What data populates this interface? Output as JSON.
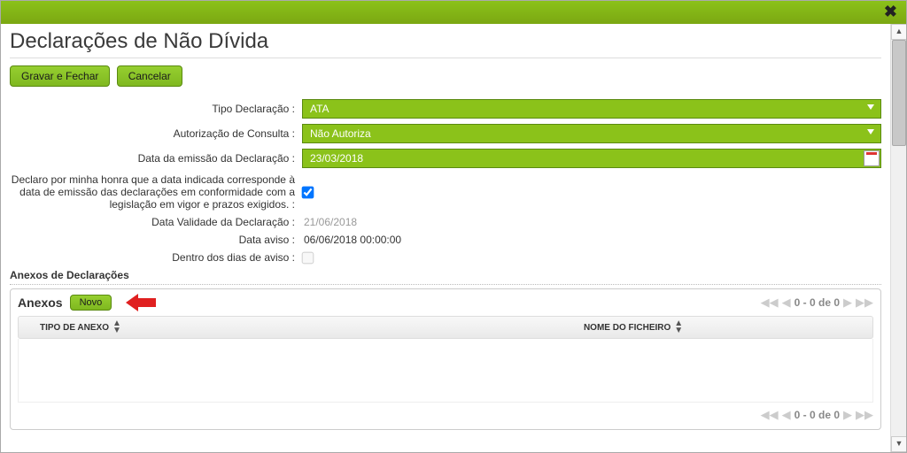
{
  "header": {
    "title": "Declarações de Não Dívida"
  },
  "buttons": {
    "save_close": "Gravar e Fechar",
    "cancel": "Cancelar",
    "new": "Novo"
  },
  "form": {
    "tipo_label": "Tipo Declaração :",
    "tipo_value": "ATA",
    "autorizacao_label": "Autorização de Consulta :",
    "autorizacao_value": "Não Autoriza",
    "data_emissao_label": "Data da emissão da Declaração :",
    "data_emissao_value": "23/03/2018",
    "declaro_label": "Declaro por minha honra que a data indicada corresponde à data de emissão das declarações em conformidade com a legislação em vigor e prazos exigidos. :",
    "declaro_checked": true,
    "validade_label": "Data Validade da Declaração :",
    "validade_value": "21/06/2018",
    "aviso_label": "Data aviso :",
    "aviso_value": "06/06/2018 00:00:00",
    "dentro_label": "Dentro dos dias de aviso :",
    "dentro_checked": false
  },
  "section": {
    "anexos_decl": "Anexos de Declarações",
    "anexos_title": "Anexos"
  },
  "grid": {
    "col_tipo": "TIPO DE ANEXO",
    "col_nome": "NOME DO FICHEIRO",
    "pager_text": "0 - 0 de 0"
  }
}
